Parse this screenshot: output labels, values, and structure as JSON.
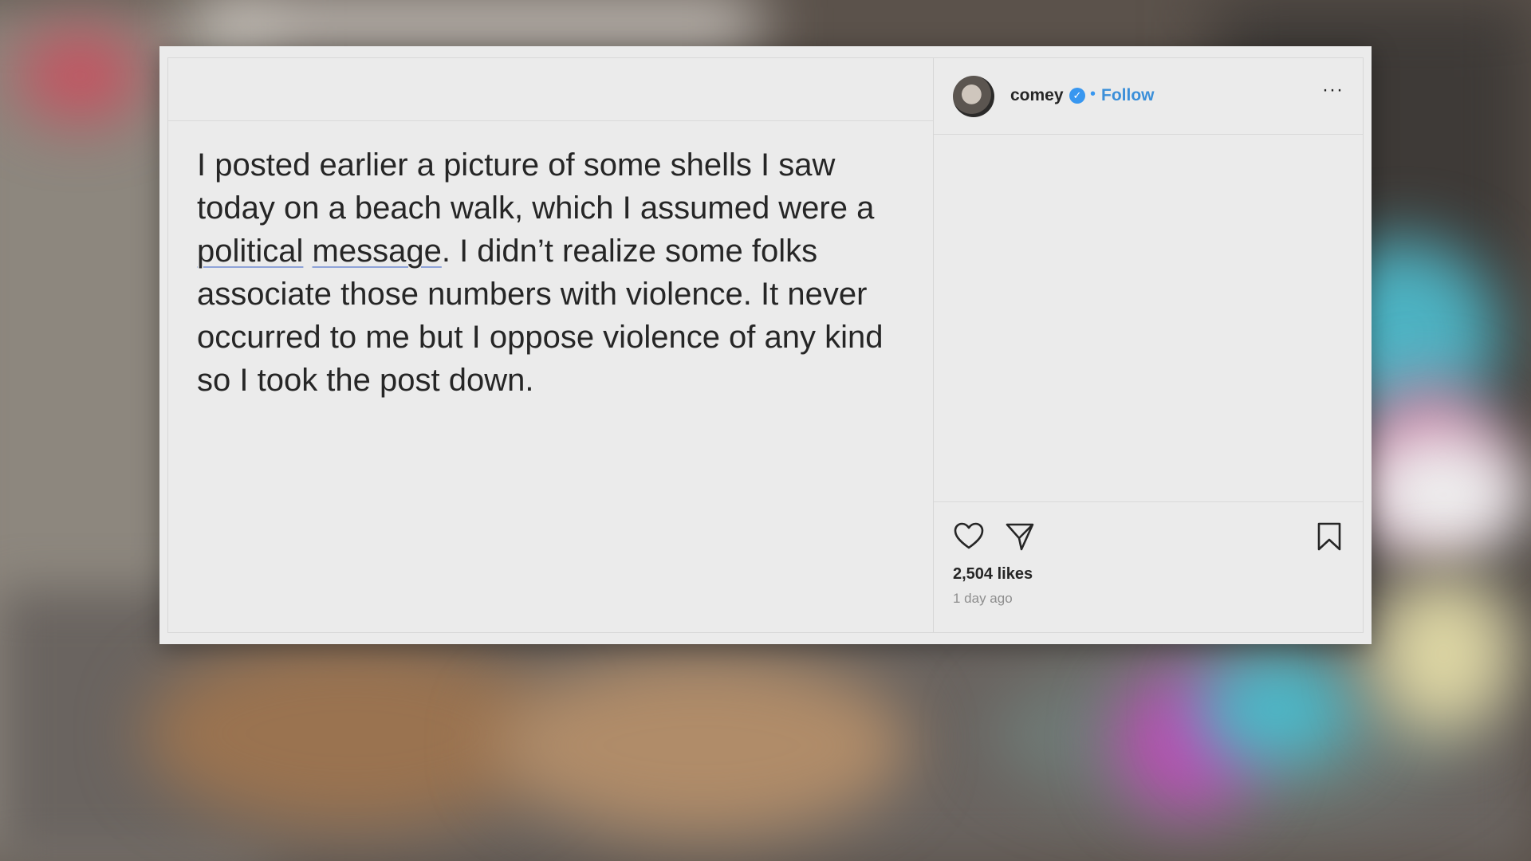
{
  "post": {
    "text_parts": {
      "before": "I posted earlier a picture of some shells I saw today on a beach walk, which I assumed were a ",
      "link1": "political",
      "space": " ",
      "link2": "message",
      "after": ". I didn’t realize some folks associate those numbers with violence. It never occurred to me but I oppose violence of any kind so I took the post down."
    }
  },
  "header": {
    "username": "comey",
    "verified_mark": "✓",
    "separator": "•",
    "follow_label": "Follow",
    "more_label": "···"
  },
  "stats": {
    "likes": "2,504 likes",
    "time": "1 day ago"
  },
  "icons": {
    "like": "heart-icon",
    "share": "send-icon",
    "save": "bookmark-icon"
  },
  "colors": {
    "accent": "#3b8fd9",
    "verified": "#3897f0",
    "text": "#262626",
    "muted": "#8e8e8e"
  }
}
